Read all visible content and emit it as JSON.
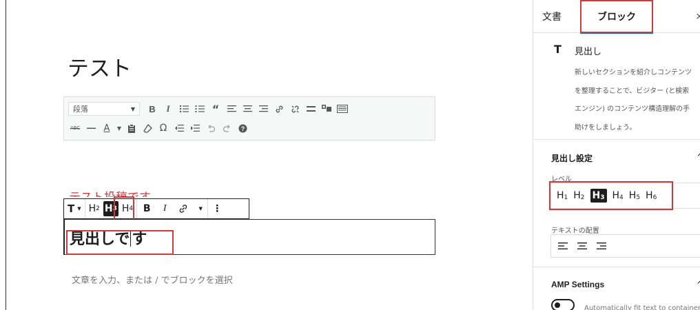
{
  "post": {
    "title": "テスト",
    "hidden_paragraph": "テスト投稿です",
    "heading_text_before": "見出しで",
    "heading_text_after": "す",
    "placeholder": "文章を入力、または / でブロックを選択"
  },
  "classic_toolbar": {
    "format_select": "段落",
    "row1_icons": [
      "bold-icon",
      "italic-icon",
      "bullet-list-icon",
      "numbered-list-icon",
      "blockquote-icon",
      "align-left-icon",
      "align-center-icon",
      "align-right-icon",
      "link-icon",
      "unlink-icon",
      "read-more-icon",
      "toolbar-toggle-icon",
      "keyboard-icon"
    ],
    "row2_icons": [
      "strikethrough-icon",
      "horizontal-line-icon",
      "text-color-icon",
      "paste-text-icon",
      "clear-formatting-icon",
      "special-character-icon",
      "outdent-icon",
      "indent-icon",
      "undo-icon",
      "redo-icon",
      "help-icon"
    ]
  },
  "block_toolbar": {
    "transform": "T",
    "h2": "H",
    "h2_sub": "2",
    "h3": "H",
    "h3_sub": "3",
    "h4": "H",
    "h4_sub": "4",
    "bold": "B",
    "italic": "I",
    "more": "⋮"
  },
  "sidebar": {
    "tab_document": "文書",
    "tab_block": "ブロック",
    "close": "×",
    "block_card": {
      "icon": "T",
      "title": "見出し",
      "description": "新しいセクションを紹介しコンテンツ\nを整理することで、ビジター (と検索\nエンジン) のコンテンツ構造理解の手\n助けをしましょう。"
    },
    "heading_settings": {
      "title": "見出し設定",
      "toggle": "^",
      "level_label": "レベル",
      "levels": [
        {
          "h": "H",
          "n": "1"
        },
        {
          "h": "H",
          "n": "2"
        },
        {
          "h": "H",
          "n": "3"
        },
        {
          "h": "H",
          "n": "4"
        },
        {
          "h": "H",
          "n": "5"
        },
        {
          "h": "H",
          "n": "6"
        }
      ],
      "active_level": 3,
      "alignment_label": "テキストの配置"
    },
    "amp": {
      "title": "AMP Settings",
      "toggle": "^",
      "description": "Automatically fit text to container"
    }
  },
  "colors": {
    "highlight": "#d63638",
    "accent": "#007cba",
    "dark": "#1e1e1e"
  }
}
